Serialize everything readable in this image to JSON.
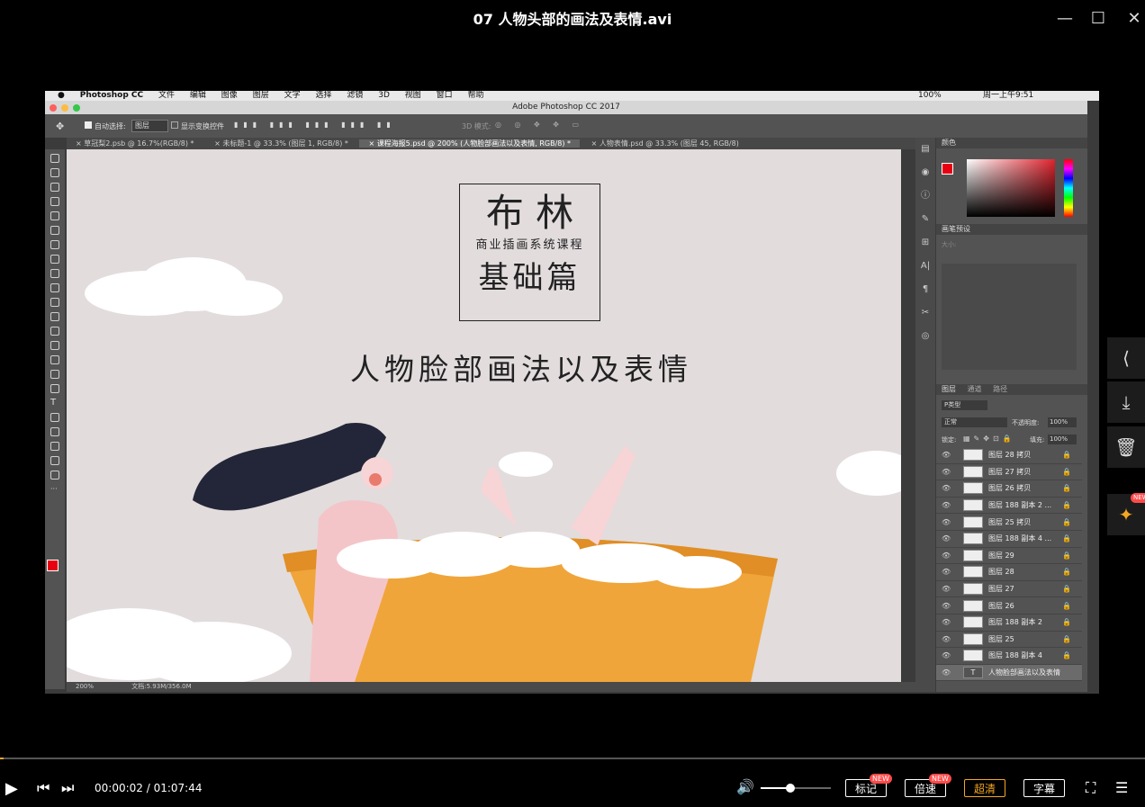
{
  "window": {
    "title": "07 人物头部的画法及表情.avi",
    "minimize": "—",
    "maximize": "☐",
    "close": "✕"
  },
  "mac_menubar": {
    "items": [
      "Photoshop CC",
      "文件",
      "编辑",
      "图像",
      "图层",
      "文字",
      "选择",
      "滤镜",
      "3D",
      "视图",
      "窗口",
      "帮助"
    ],
    "battery": "100%",
    "clock": "周一上午9:51"
  },
  "photoshop": {
    "window_title": "Adobe Photoshop CC 2017",
    "options": {
      "auto_select_label": "自动选择:",
      "auto_select_value": "图层",
      "show_transform_label": "显示变换控件",
      "mode_3d_label": "3D 模式:"
    },
    "tabs": [
      "草冠梨2.psb @ 16.7%(RGB/8) *",
      "未标题-1 @ 33.3% (图层 1, RGB/8) *",
      "课程海报5.psd @ 200% (人物脸部画法以及表情, RGB/8) *",
      "人物表情.psd @ 33.3% (图层 45, RGB/8)"
    ],
    "artwork": {
      "title_big": "布  林",
      "subtitle": "商业插画系统课程",
      "series": "基础篇",
      "lesson_title": "人物脸部画法以及表情"
    },
    "status": {
      "zoom": "200%",
      "doc": "文档:5.93M/356.0M"
    },
    "panels": {
      "color_title": "颜色",
      "brush_preset_title": "画笔预设",
      "brush_size_label": "大小:",
      "layers_tabs": [
        "图层",
        "通道",
        "路径"
      ],
      "kind_label": "P类型",
      "blend_mode": "正常",
      "opacity_label": "不透明度:",
      "opacity_value": "100%",
      "lock_label": "锁定:",
      "fill_label": "填充:",
      "fill_value": "100%",
      "layers": [
        "图层 28 拷贝",
        "图层 27 拷贝",
        "图层 26 拷贝",
        "图层 188 副本 2 ...",
        "图层 25 拷贝",
        "图层 188 副本 4 ...",
        "图层 29",
        "图层 28",
        "图层 27",
        "图层 26",
        "图层 188 副本 2",
        "图层 25",
        "图层 188 副本 4"
      ],
      "text_layer": "人物脸部画法以及表情"
    }
  },
  "player": {
    "time": "00:00:02 / 01:07:44",
    "volume_fraction": 0.42,
    "progress_fraction": 0.0005,
    "buttons": {
      "mark": "标记",
      "speed": "倍速",
      "quality": "超清",
      "subtitle": "字幕"
    },
    "new_badge": "NEW",
    "pin_badge": "NEW"
  },
  "colors": {
    "accent_orange": "#f5a623",
    "badge_red": "#ff4a4a",
    "tub_orange": "#f0a53a",
    "hair_dark": "#232638"
  }
}
